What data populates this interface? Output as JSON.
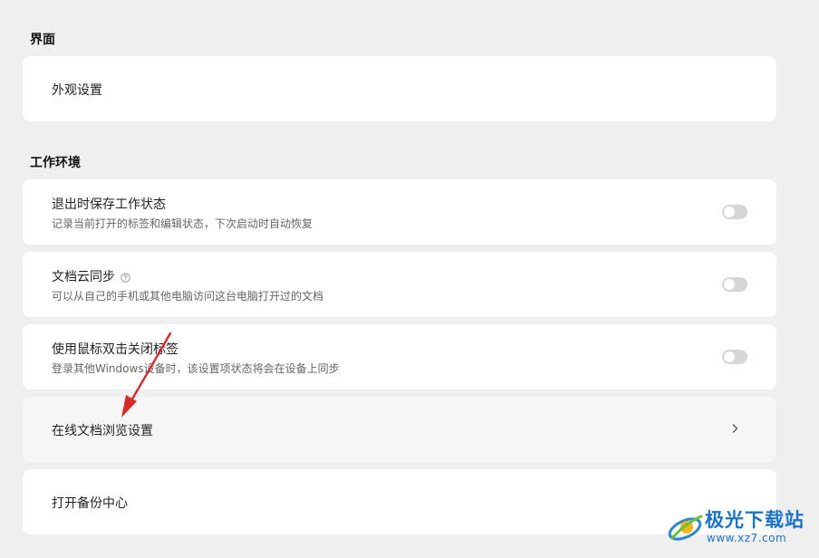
{
  "sections": {
    "interface": {
      "title": "界面",
      "items": [
        {
          "title": "外观设置"
        }
      ]
    },
    "workspace": {
      "title": "工作环境",
      "items": [
        {
          "title": "退出时保存工作状态",
          "desc": "记录当前打开的标签和编辑状态，下次启动时自动恢复",
          "control": "toggle",
          "enabled": false
        },
        {
          "title": "文档云同步",
          "desc": "可以从自己的手机或其他电脑访问这台电脑打开过的文档",
          "control": "toggle",
          "enabled": false,
          "help_icon": "help-circle-icon"
        },
        {
          "title": "使用鼠标双击关闭标签",
          "desc": "登录其他Windows设备时，该设置项状态将会在设备上同步",
          "control": "toggle",
          "enabled": false
        },
        {
          "title": "在线文档浏览设置",
          "control": "chevron",
          "icon": "chevron-right-icon"
        },
        {
          "title": "打开备份中心"
        }
      ]
    }
  },
  "watermark": {
    "brand": "极光下载站",
    "url": "www.xz7.com"
  },
  "colors": {
    "background": "#efefef",
    "card": "#ffffff",
    "card_hover": "#f6f6f6",
    "toggle_off": "#d6d6d6",
    "annotation_arrow": "#d42a2a",
    "watermark": "#1c73c6"
  }
}
